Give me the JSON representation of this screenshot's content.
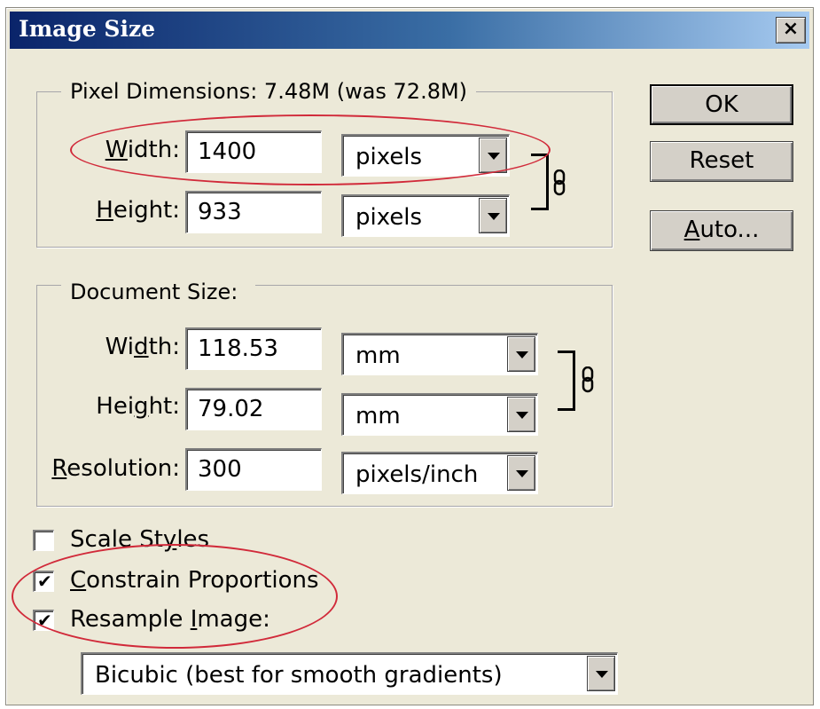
{
  "window": {
    "title": "Image Size",
    "close_glyph": "×"
  },
  "pixel_dimensions": {
    "legend": "Pixel Dimensions:  7.48M (was 72.8M)",
    "width": {
      "label_pre": "",
      "label_key": "W",
      "label_post": "idth:",
      "value": "1400",
      "unit": "pixels"
    },
    "height": {
      "label_pre": "",
      "label_key": "H",
      "label_post": "eight:",
      "value": "933",
      "unit": "pixels"
    }
  },
  "document_size": {
    "legend": "Document Size:",
    "width": {
      "label_pre": "Wi",
      "label_key": "d",
      "label_post": "th:",
      "value": "118.53",
      "unit": "mm"
    },
    "height": {
      "label_pre": "Hei",
      "label_key": "g",
      "label_post": "ht:",
      "value": "79.02",
      "unit": "mm"
    },
    "resolution": {
      "label_pre": "",
      "label_key": "R",
      "label_post": "esolution:",
      "value": "300",
      "unit": "pixels/inch"
    }
  },
  "buttons": {
    "ok": "OK",
    "reset": "Reset",
    "auto_key": "A",
    "auto_rest": "uto..."
  },
  "options": {
    "scale_styles": {
      "pre": "Scale St",
      "key": "y",
      "post": "les",
      "checked": false
    },
    "constrain": {
      "pre": "",
      "key": "C",
      "post": "onstrain Proportions",
      "checked": true
    },
    "resample": {
      "pre": "Resample ",
      "key": "I",
      "post": "mage:",
      "checked": true
    },
    "check_glyph": "✔"
  },
  "resample_method": "Bicubic (best for smooth gradients)",
  "icons": {
    "link": "link-chain-icon",
    "dropdown": "dropdown-arrow-icon",
    "checkbox": "checkmark-icon",
    "close": "close-icon"
  },
  "colors": {
    "annotation": "#d12a3a",
    "titlebar": "#0a246a",
    "dialog": "#ece9d8"
  }
}
